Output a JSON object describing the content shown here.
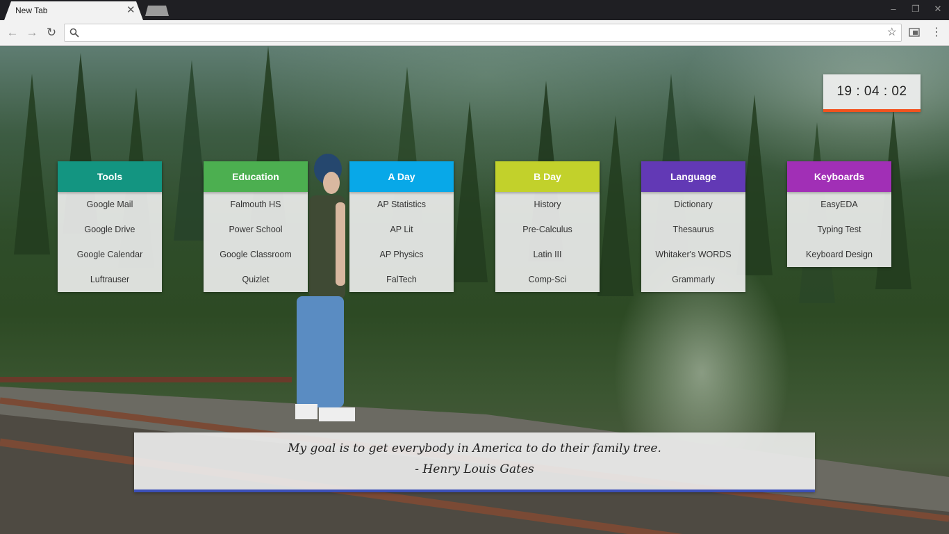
{
  "browser": {
    "tab_title": "New Tab",
    "tab_close_icon": "close-icon",
    "omnibox_value": "",
    "omnibox_placeholder": ""
  },
  "clock": {
    "time": "19 : 04 : 02"
  },
  "cards": [
    {
      "title": "Tools",
      "color": "#139581",
      "links": [
        "Google Mail",
        "Google Drive",
        "Google Calendar",
        "Luftrauser"
      ]
    },
    {
      "title": "Education",
      "color": "#4caf50",
      "links": [
        "Falmouth HS",
        "Power School",
        "Google Classroom",
        "Quizlet"
      ]
    },
    {
      "title": "A Day",
      "color": "#08a8e8",
      "links": [
        "AP Statistics",
        "AP Lit",
        "AP Physics",
        "FalTech"
      ]
    },
    {
      "title": "B Day",
      "color": "#c2d12b",
      "links": [
        "History",
        "Pre-Calculus",
        "Latin III",
        "Comp-Sci"
      ]
    },
    {
      "title": "Language",
      "color": "#6239b5",
      "links": [
        "Dictionary",
        "Thesaurus",
        "Whitaker's WORDS",
        "Grammarly"
      ]
    },
    {
      "title": "Keyboards",
      "color": "#a12fb6",
      "links": [
        "EasyEDA",
        "Typing Test",
        "Keyboard Design"
      ]
    }
  ],
  "quote": {
    "text": "My goal is to get everybody in America to do their family tree.",
    "author": "- Henry Louis Gates"
  },
  "colors": {
    "clock_accent": "#f2521e",
    "quote_accent": "#3b4fb8"
  }
}
